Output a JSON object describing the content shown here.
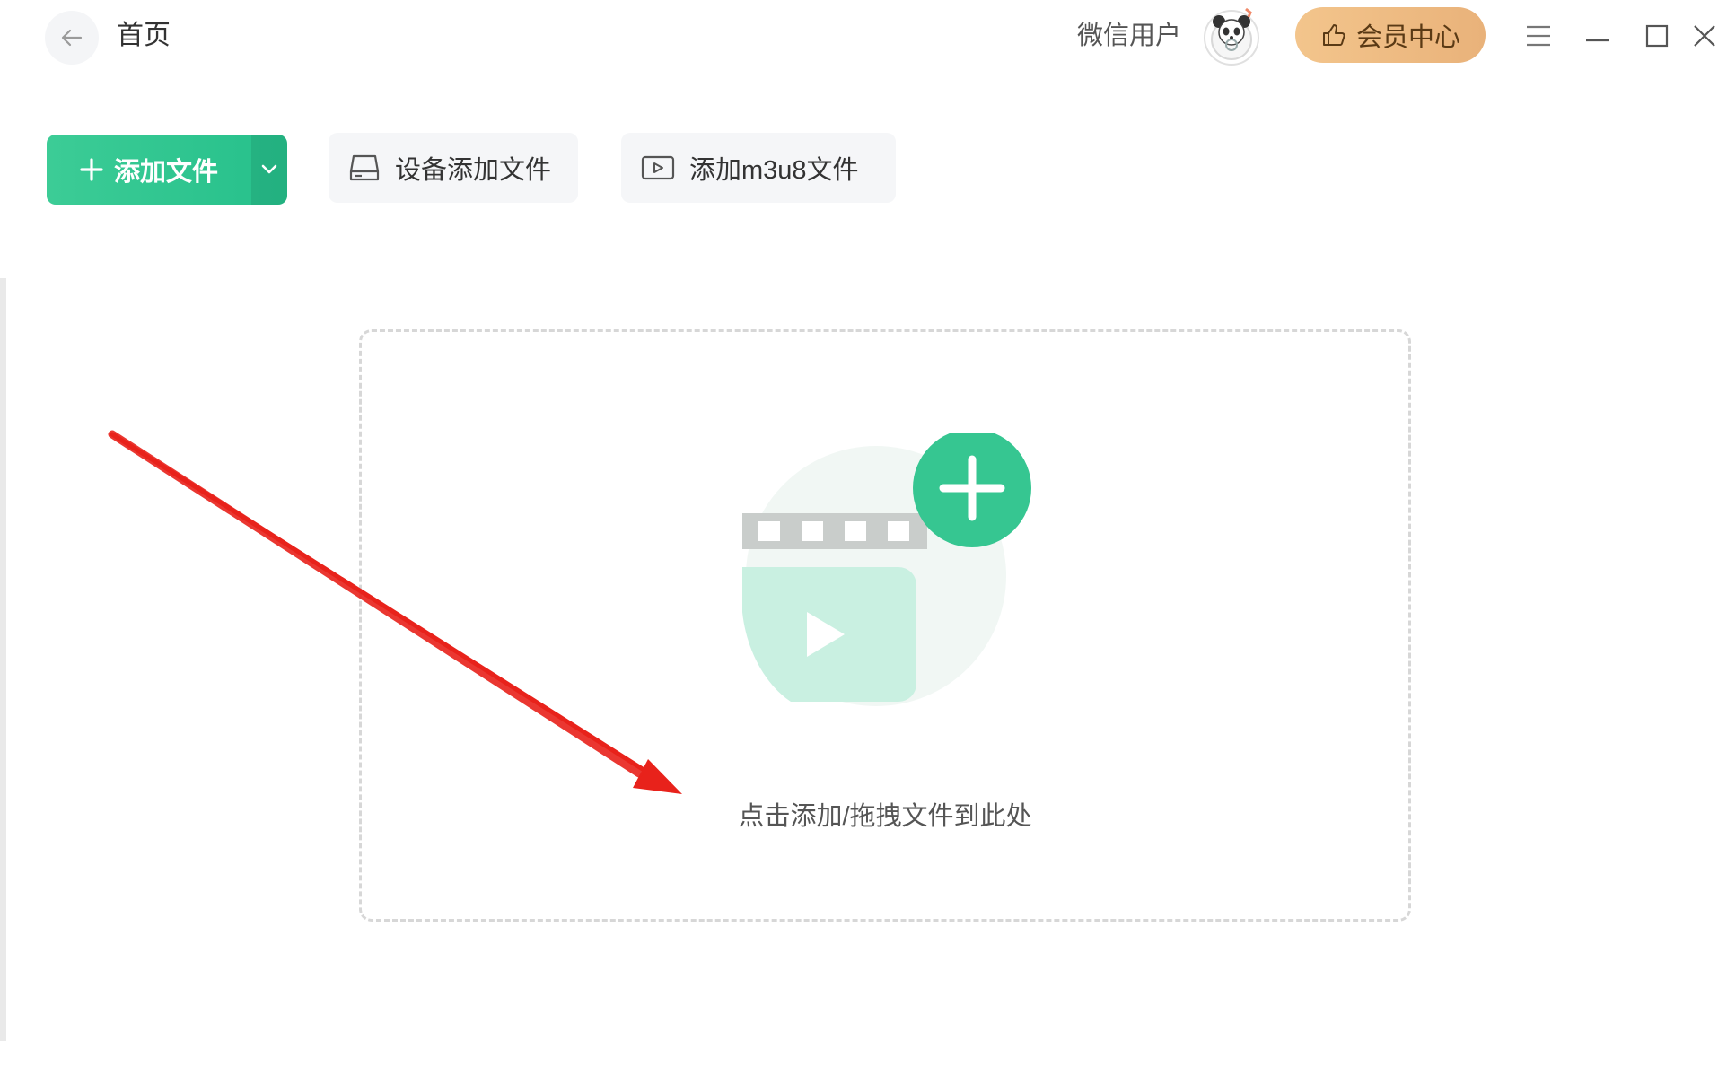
{
  "header": {
    "title": "首页",
    "user_name": "微信用户",
    "vip_label": "会员中心"
  },
  "toolbar": {
    "add_file_label": "添加文件",
    "device_add_label": "设备添加文件",
    "m3u8_add_label": "添加m3u8文件"
  },
  "dropzone": {
    "hint": "点击添加/拖拽文件到此处"
  },
  "colors": {
    "primary": "#2cc48e",
    "vip": "#eebb82",
    "annotation": "#e8221b"
  },
  "icons": {
    "back": "arrow-left-icon",
    "avatar": "panda-avatar",
    "vip": "thumbs-up-icon",
    "menu": "hamburger-icon",
    "minimize": "minimize-icon",
    "maximize": "maximize-icon",
    "close": "close-icon",
    "device": "drive-icon",
    "m3u8": "play-box-icon"
  }
}
